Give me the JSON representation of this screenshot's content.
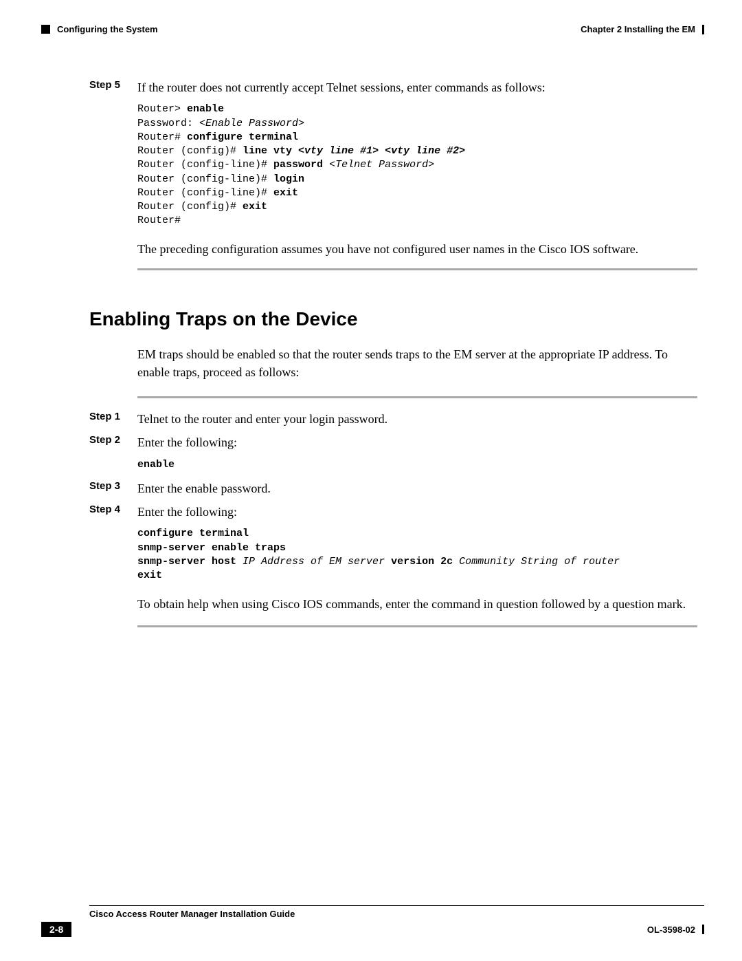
{
  "header": {
    "section": "Configuring the System",
    "chapter": "Chapter 2      Installing the EM"
  },
  "step5": {
    "label": "Step 5",
    "text": "If the router does not currently accept Telnet sessions, enter commands as follows:"
  },
  "code5": {
    "l1a": "Router> ",
    "l1b": "enable",
    "l2a": "Password: ",
    "l2b": "<Enable Password>",
    "l3a": "Router# ",
    "l3b": "configure terminal",
    "l4a": "Router (config)# ",
    "l4b": "line vty ",
    "l4c": "<vty line #1> <vty line #2>",
    "l5a": "Router (config-line)# ",
    "l5b": "password ",
    "l5c": "<Telnet Password>",
    "l6a": "Router (config-line)# ",
    "l6b": "login",
    "l7a": "Router (config-line)# ",
    "l7b": "exit",
    "l8a": "Router (config)# ",
    "l8b": "exit",
    "l9": "Router#"
  },
  "para1": "The preceding configuration assumes you have not configured user names in the Cisco IOS software.",
  "h2": "Enabling Traps on the Device",
  "para2": "EM traps should be enabled so that the router sends traps to the EM server at the appropriate IP address. To enable traps, proceed as follows:",
  "stepA": {
    "label": "Step 1",
    "text": "Telnet to the router and enter your login password."
  },
  "stepB": {
    "label": "Step 2",
    "text": "Enter the following:"
  },
  "codeB": "enable",
  "stepC": {
    "label": "Step 3",
    "text": "Enter the enable password."
  },
  "stepD": {
    "label": "Step 4",
    "text": "Enter the following:"
  },
  "codeD": {
    "l1": "configure terminal",
    "l2": "snmp-server enable traps",
    "l3a": "snmp-server host ",
    "l3b": "IP Address of EM server ",
    "l3c": "version 2c ",
    "l3d": "Community String of router",
    "l4": "exit"
  },
  "para3": "To obtain help when using Cisco IOS commands, enter the command in question followed by a question mark.",
  "footer": {
    "title": "Cisco Access Router Manager Installation Guide",
    "page": "2-8",
    "docid": "OL-3598-02"
  }
}
